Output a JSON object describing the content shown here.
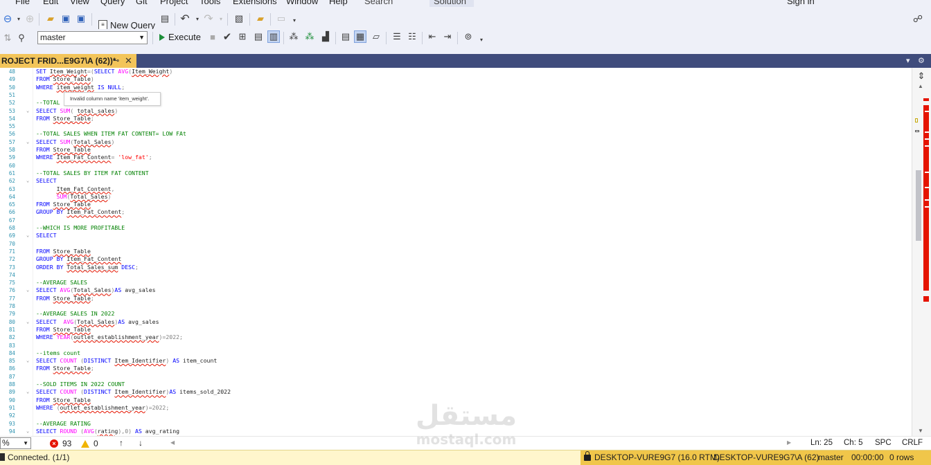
{
  "menu": {
    "items": [
      "File",
      "Edit",
      "View",
      "Query",
      "Git",
      "Project",
      "Tools",
      "Extensions",
      "Window",
      "Help"
    ],
    "search_label": "Search",
    "solution_label": "Solution",
    "signin_label": "Sign in"
  },
  "toolbar": {
    "new_query_label": "New Query",
    "database": "master",
    "execute_label": "Execute"
  },
  "tab": {
    "title": "ROJECT FRID...E9G7\\A (62))*"
  },
  "editor": {
    "tooltip": "Invalid column name 'item_weight'.",
    "lines": [
      {
        "n": "48",
        "text": "SET Item_Weight=(SELECT AVG(Item_Weight)"
      },
      {
        "n": "49",
        "text": "FROM Store_Table)"
      },
      {
        "n": "50",
        "text": "WHERE item_weight IS NULL;"
      },
      {
        "n": "51",
        "text": ""
      },
      {
        "n": "52",
        "text": "--TOTAL"
      },
      {
        "n": "53",
        "text": "SELECT SUM( total_sales)"
      },
      {
        "n": "54",
        "text": "FROM Store_Table;"
      },
      {
        "n": "55",
        "text": ""
      },
      {
        "n": "56",
        "text": "--TOTAL SALES WHEN ITEM FAT CONTENT= LOW FAt"
      },
      {
        "n": "57",
        "text": "SELECT SUM(Total_Sales)"
      },
      {
        "n": "58",
        "text": "FROM Store_Table"
      },
      {
        "n": "59",
        "text": "WHERE Item_Fat_Content= 'low_fat';"
      },
      {
        "n": "60",
        "text": ""
      },
      {
        "n": "61",
        "text": "--TOTAL SALES BY ITEM FAT CONTENT"
      },
      {
        "n": "62",
        "text": "SELECT"
      },
      {
        "n": "63",
        "text": "      Item_Fat_Content,"
      },
      {
        "n": "64",
        "text": "      SUM(Total_Sales)"
      },
      {
        "n": "65",
        "text": "FROM Store_Table"
      },
      {
        "n": "66",
        "text": "GROUP BY Item_Fat_Content;"
      },
      {
        "n": "67",
        "text": ""
      },
      {
        "n": "68",
        "text": "--WHICH IS MORE PROFITABLE"
      },
      {
        "n": "69",
        "text": "SELECT"
      },
      {
        "n": "70",
        "text": ""
      },
      {
        "n": "71",
        "text": "FROM Store_Table"
      },
      {
        "n": "72",
        "text": "GROUP BY Item_Fat_Content"
      },
      {
        "n": "73",
        "text": "ORDER BY Total_Sales_sum DESC;"
      },
      {
        "n": "74",
        "text": ""
      },
      {
        "n": "75",
        "text": "--AVERAGE SALES"
      },
      {
        "n": "76",
        "text": "SELECT AVG(Total_Sales)AS avg_sales"
      },
      {
        "n": "77",
        "text": "FROM Store_Table;"
      },
      {
        "n": "78",
        "text": ""
      },
      {
        "n": "79",
        "text": "--AVERAGE SALES IN 2022"
      },
      {
        "n": "80",
        "text": "SELECT  AVG(Total_Sales)AS avg_sales"
      },
      {
        "n": "81",
        "text": "FROM Store_Table"
      },
      {
        "n": "82",
        "text": "WHERE YEAR(outlet_establishment_year)=2022;"
      },
      {
        "n": "83",
        "text": ""
      },
      {
        "n": "84",
        "text": "--items count"
      },
      {
        "n": "85",
        "text": "SELECT COUNT (DISTINCT Item_Identifier) AS item_count"
      },
      {
        "n": "86",
        "text": "FROM Store_Table;"
      },
      {
        "n": "87",
        "text": ""
      },
      {
        "n": "88",
        "text": "--SOLD ITEMS IN 2022 COUNT"
      },
      {
        "n": "89",
        "text": "SELECT COUNT (DISTINCT Item_Identifier)AS items_sold_2022"
      },
      {
        "n": "90",
        "text": "FROM Store_Table"
      },
      {
        "n": "91",
        "text": "WHERE (outlet_establishment_year)=2022;"
      },
      {
        "n": "92",
        "text": ""
      },
      {
        "n": "93",
        "text": "--AVERAGE RATING"
      },
      {
        "n": "94",
        "text": "SELECT ROUND (AVG(rating),0) AS avg_rating"
      }
    ]
  },
  "editor_bar": {
    "zoom": "%",
    "errors": "93",
    "warnings": "0",
    "ln": "Ln: 25",
    "ch": "Ch: 5",
    "spc": "SPC",
    "crlf": "CRLF"
  },
  "status": {
    "connected": "Connected. (1/1)",
    "server": "DESKTOP-VURE9G7 (16.0 RTM)",
    "user": "DESKTOP-VURE9G7\\A (62)",
    "database": "master",
    "elapsed": "00:00:00",
    "rows": "0 rows"
  },
  "watermark": {
    "arabic": "مستقل",
    "latin": "mostaql.com"
  },
  "colors": {
    "tab_active": "#f3c55a",
    "tabstrip": "#3f4c7c",
    "status_bar": "#f0c64a",
    "error": "#e51400",
    "keyword": "#0000ff",
    "function": "#ff00ff",
    "comment": "#008000",
    "string": "#ff0000"
  }
}
